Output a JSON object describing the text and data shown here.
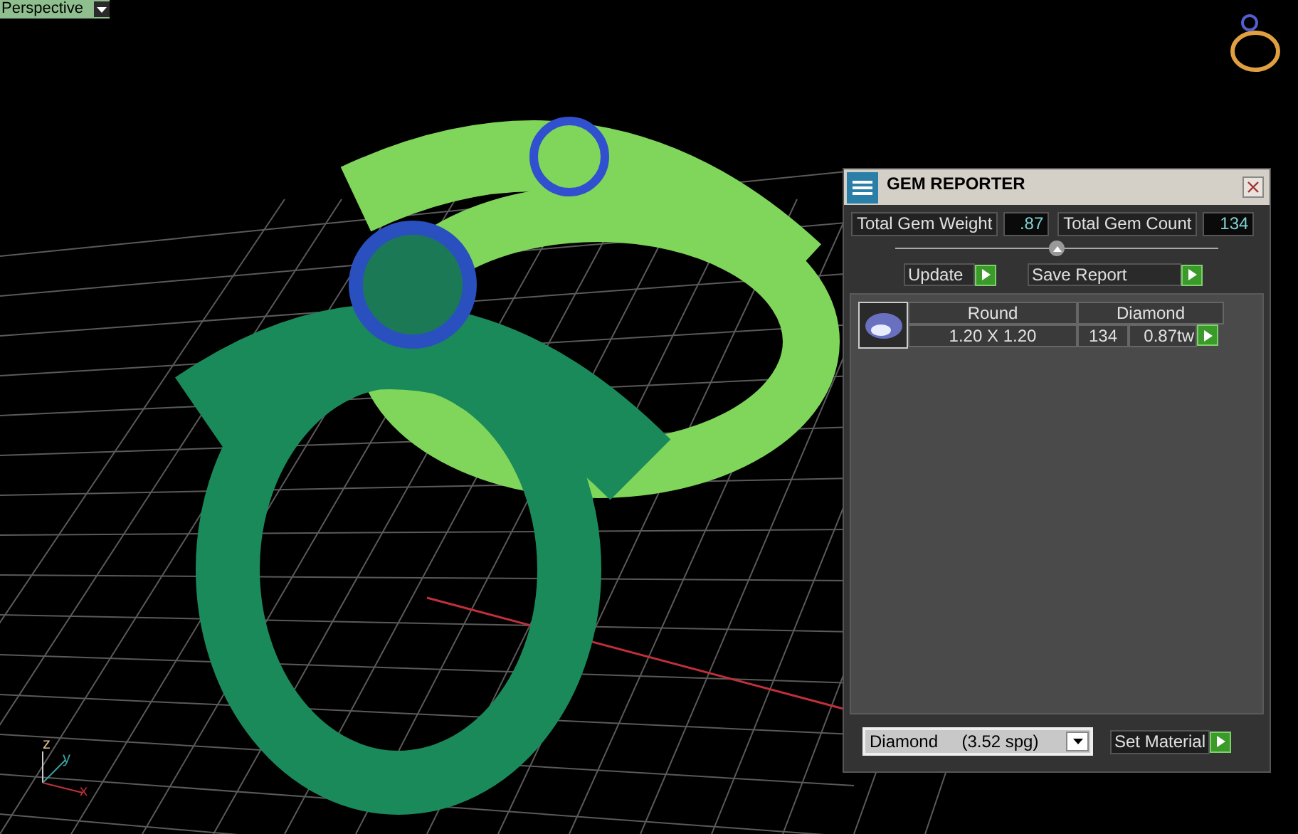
{
  "viewport": {
    "view_label": "Perspective",
    "axes": [
      "z",
      "y",
      "x"
    ]
  },
  "gem_reporter": {
    "title": "GEM REPORTER",
    "total_weight_label": "Total Gem Weight",
    "total_weight": ".87",
    "total_count_label": "Total Gem Count",
    "total_count": "134",
    "buttons": [
      "Update",
      "Save Report"
    ],
    "gems": [
      {
        "shape": "Round",
        "size": "1.20 X 1.20",
        "material": "Diamond",
        "count": "134",
        "weight": "0.87tw"
      }
    ],
    "material_select": "Diamond     (3.52 spg)",
    "set_button": "Set Material"
  }
}
